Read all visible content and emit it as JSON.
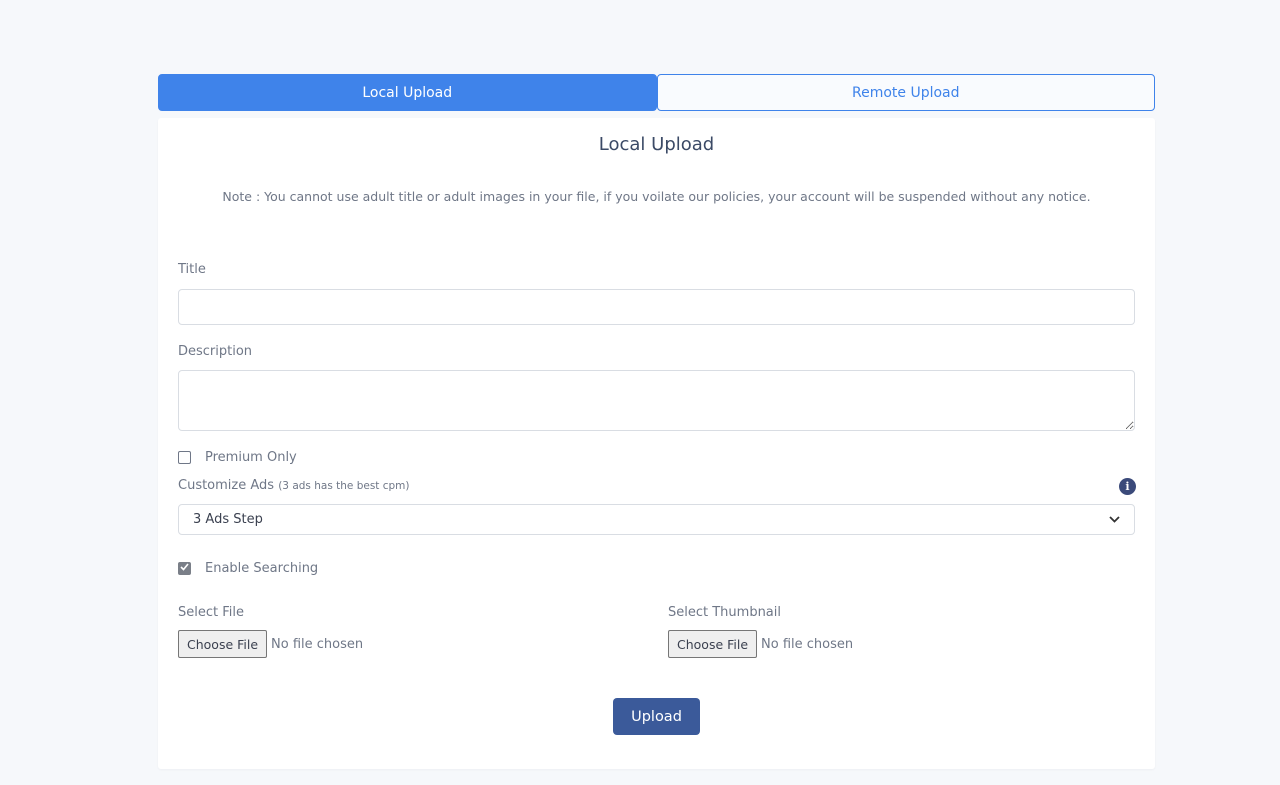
{
  "tabs": {
    "local": "Local Upload",
    "remote": "Remote Upload"
  },
  "form": {
    "heading": "Local Upload",
    "note": "Note : You cannot use adult title or adult images in your file, if you voilate our policies, your account will be suspended without any notice.",
    "title_label": "Title",
    "title_value": "",
    "description_label": "Description",
    "description_value": "",
    "premium_label": "Premium Only",
    "premium_checked": false,
    "ads_label": "Customize Ads",
    "ads_hint": "(3 ads has the best cpm)",
    "ads_selected": "3 Ads Step",
    "searching_label": "Enable Searching",
    "searching_checked": true,
    "file_label": "Select File",
    "thumbnail_label": "Select Thumbnail",
    "choose_file": "Choose File",
    "no_file": "No file chosen",
    "upload_button": "Upload"
  },
  "colors": {
    "accent": "#3f83ea",
    "upload_button": "#3b5a9a",
    "page_background": "#f6f8fb"
  },
  "icons": {
    "info": "info-icon",
    "dropdown": "chevron-down-icon",
    "check": "check-icon"
  }
}
